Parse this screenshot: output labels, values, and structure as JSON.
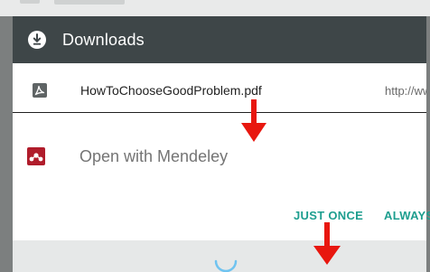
{
  "appbar": {
    "title": "Downloads",
    "icon": "download-circle-icon"
  },
  "file": {
    "name": "HowToChooseGoodProblem.pdf",
    "url": "http://ww",
    "icon": "pdf-icon"
  },
  "chooser": {
    "option_label": "Open with Mendeley",
    "app_icon": "mendeley-icon"
  },
  "actions": {
    "just_once": "JUST ONCE",
    "always": "ALWAYS"
  },
  "colors": {
    "appbar_bg": "#3e4648",
    "accent": "#1e9e8f",
    "arrow": "#e8170f",
    "mendeley": "#b01c2b"
  }
}
